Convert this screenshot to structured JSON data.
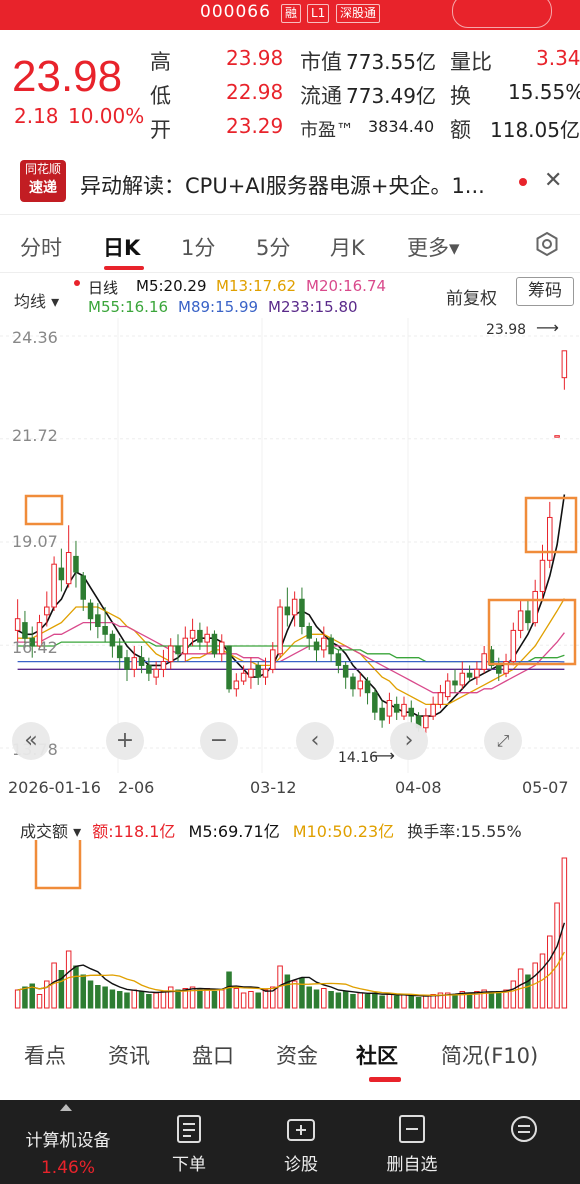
{
  "header": {
    "code": "000066",
    "tags": [
      "融",
      "L1",
      "深股通"
    ]
  },
  "quote": {
    "price": "23.98",
    "change": "2.18",
    "change_pct": "10.00%",
    "high_label": "高",
    "high": "23.98",
    "low_label": "低",
    "low": "22.98",
    "open_label": "开",
    "open": "23.29",
    "mktcap_label": "市值",
    "mktcap": "773.55亿",
    "float_label": "流通",
    "float": "773.49亿",
    "pe_label": "市盈™",
    "pe": "3834.40",
    "volratio_label": "量比",
    "volratio": "3.34",
    "turnover_label": "换",
    "turnover": "15.55%",
    "amount_label": "额",
    "amount": "118.05亿"
  },
  "news": {
    "logo_top": "同花顺",
    "logo_bottom": "速递",
    "text": "异动解读：CPU+AI服务器电源+央企。1..."
  },
  "period_tabs": [
    "分时",
    "日K",
    "1分",
    "5分",
    "月K",
    "更多▾"
  ],
  "ma_bar": {
    "left_label": "均线 ▾",
    "line_label": "日线",
    "m5": "M5:20.29",
    "m13": "M13:17.62",
    "m20": "M20:16.74",
    "m55": "M55:16.16",
    "m89": "M89:15.99",
    "m233": "M233:15.80",
    "adj_label": "前复权",
    "chips_label": "筹码"
  },
  "chart_data": {
    "type": "candlestick",
    "y_ticks": [
      "24.36",
      "21.72",
      "19.07",
      "16.42",
      "13.78"
    ],
    "x_ticks": [
      "2026-01-16",
      "2-06",
      "03-12",
      "04-08",
      "05-07"
    ],
    "high_marker": "23.98",
    "low_marker": "14.16",
    "candles": [
      [
        16.8,
        17.1,
        17.6,
        16.5
      ],
      [
        17.0,
        16.6,
        17.3,
        16.4
      ],
      [
        16.6,
        16.4,
        16.9,
        16.1
      ],
      [
        16.4,
        17.0,
        17.2,
        16.3
      ],
      [
        17.2,
        17.4,
        17.8,
        16.9
      ],
      [
        17.4,
        18.5,
        18.7,
        17.3
      ],
      [
        18.4,
        18.1,
        18.9,
        17.8
      ],
      [
        18.0,
        18.8,
        19.5,
        17.9
      ],
      [
        18.7,
        18.3,
        19.1,
        17.9
      ],
      [
        18.2,
        17.6,
        18.3,
        17.3
      ],
      [
        17.5,
        17.1,
        17.6,
        16.8
      ],
      [
        17.2,
        16.9,
        17.5,
        16.6
      ],
      [
        16.9,
        16.7,
        17.4,
        16.5
      ],
      [
        16.7,
        16.4,
        16.8,
        16.1
      ],
      [
        16.4,
        16.1,
        16.6,
        15.8
      ],
      [
        16.1,
        15.8,
        16.3,
        15.5
      ],
      [
        15.8,
        16.1,
        16.4,
        15.6
      ],
      [
        16.1,
        15.9,
        16.4,
        15.7
      ],
      [
        15.9,
        15.7,
        16.1,
        15.5
      ],
      [
        15.6,
        15.8,
        16.0,
        15.4
      ],
      [
        15.8,
        16.0,
        16.3,
        15.6
      ],
      [
        16.0,
        16.4,
        16.6,
        15.8
      ],
      [
        16.4,
        16.2,
        16.7,
        16.0
      ],
      [
        16.2,
        16.6,
        16.9,
        16.0
      ],
      [
        16.6,
        16.8,
        17.1,
        16.4
      ],
      [
        16.8,
        16.5,
        17.0,
        16.3
      ],
      [
        16.5,
        16.7,
        16.9,
        16.2
      ],
      [
        16.7,
        16.2,
        16.8,
        16.1
      ],
      [
        16.2,
        16.5,
        16.7,
        16.0
      ],
      [
        16.4,
        15.3,
        16.4,
        15.2
      ],
      [
        15.3,
        15.5,
        15.7,
        15.1
      ],
      [
        15.5,
        15.7,
        15.9,
        15.4
      ],
      [
        15.6,
        15.8,
        16.1,
        15.3
      ],
      [
        15.9,
        15.6,
        16.0,
        15.4
      ],
      [
        15.6,
        15.8,
        16.1,
        15.4
      ],
      [
        15.8,
        16.3,
        16.5,
        15.7
      ],
      [
        16.2,
        17.4,
        17.6,
        16.1
      ],
      [
        17.4,
        17.2,
        17.9,
        16.9
      ],
      [
        17.2,
        17.6,
        17.8,
        16.9
      ],
      [
        17.6,
        16.9,
        17.9,
        16.7
      ],
      [
        16.9,
        16.6,
        17.0,
        16.3
      ],
      [
        16.5,
        16.3,
        16.6,
        16.0
      ],
      [
        16.3,
        16.6,
        16.9,
        16.1
      ],
      [
        16.6,
        16.2,
        16.7,
        16.0
      ],
      [
        16.2,
        15.9,
        16.3,
        15.7
      ],
      [
        15.9,
        15.6,
        16.0,
        15.3
      ],
      [
        15.6,
        15.3,
        15.7,
        15.1
      ],
      [
        15.3,
        15.5,
        15.7,
        15.1
      ],
      [
        15.5,
        15.2,
        15.6,
        14.9
      ],
      [
        15.2,
        14.7,
        15.3,
        14.5
      ],
      [
        14.8,
        14.5,
        15.0,
        14.3
      ],
      [
        14.6,
        15.0,
        15.2,
        14.4
      ],
      [
        14.9,
        14.7,
        15.1,
        14.5
      ],
      [
        14.6,
        14.9,
        15.1,
        14.5
      ],
      [
        14.8,
        14.6,
        15.0,
        14.4
      ],
      [
        14.6,
        14.3,
        14.7,
        14.2
      ],
      [
        14.3,
        14.6,
        14.8,
        14.16
      ],
      [
        14.6,
        14.9,
        15.1,
        14.5
      ],
      [
        14.9,
        15.2,
        15.4,
        14.8
      ],
      [
        15.1,
        15.5,
        15.7,
        15.0
      ],
      [
        15.5,
        15.4,
        15.8,
        15.2
      ],
      [
        15.4,
        15.7,
        16.0,
        15.3
      ],
      [
        15.7,
        15.6,
        15.9,
        15.5
      ],
      [
        15.6,
        15.8,
        16.0,
        15.4
      ],
      [
        15.8,
        16.2,
        16.4,
        15.7
      ],
      [
        16.3,
        15.9,
        16.4,
        15.8
      ],
      [
        15.9,
        15.7,
        16.1,
        15.5
      ],
      [
        15.7,
        16.0,
        16.2,
        15.6
      ],
      [
        16.0,
        16.8,
        17.0,
        15.9
      ],
      [
        16.8,
        17.3,
        17.6,
        16.6
      ],
      [
        17.3,
        17.0,
        17.6,
        16.8
      ],
      [
        17.0,
        17.8,
        18.1,
        16.9
      ],
      [
        17.8,
        18.6,
        19.0,
        17.6
      ],
      [
        18.6,
        19.7,
        20.1,
        18.4
      ],
      [
        21.8,
        21.8,
        21.8,
        21.8
      ],
      [
        23.29,
        23.98,
        23.98,
        22.98
      ]
    ],
    "ma_lines": {
      "m5": [
        16.8,
        16.7,
        16.7,
        16.8,
        17.0,
        17.4,
        17.6,
        18.0,
        18.3,
        18.2,
        17.9,
        17.6,
        17.3,
        17.0,
        16.7,
        16.4,
        16.2,
        16.1,
        15.9,
        15.9,
        15.9,
        16.0,
        16.1,
        16.3,
        16.5,
        16.6,
        16.6,
        16.6,
        16.5,
        16.2,
        16.0,
        15.8,
        15.6,
        15.6,
        15.7,
        15.9,
        16.3,
        16.8,
        17.2,
        17.3,
        17.2,
        16.9,
        16.7,
        16.5,
        16.4,
        16.2,
        15.9,
        15.7,
        15.5,
        15.3,
        15.0,
        14.9,
        14.8,
        14.7,
        14.7,
        14.6,
        14.6,
        14.6,
        14.7,
        14.9,
        15.1,
        15.3,
        15.5,
        15.6,
        15.7,
        15.8,
        15.9,
        15.9,
        16.1,
        16.4,
        16.7,
        17.1,
        17.6,
        18.2,
        19.0,
        20.29
      ],
      "m13": [
        16.6,
        16.6,
        16.6,
        16.7,
        16.8,
        16.9,
        17.0,
        17.2,
        17.4,
        17.4,
        17.4,
        17.4,
        17.3,
        17.2,
        17.1,
        16.9,
        16.8,
        16.6,
        16.4,
        16.2,
        16.1,
        16.0,
        16.0,
        16.0,
        16.1,
        16.1,
        16.2,
        16.3,
        16.3,
        16.2,
        16.1,
        16.0,
        16.0,
        15.9,
        15.9,
        15.9,
        16.1,
        16.3,
        16.5,
        16.6,
        16.7,
        16.7,
        16.7,
        16.6,
        16.5,
        16.4,
        16.3,
        16.2,
        16.0,
        15.8,
        15.6,
        15.5,
        15.3,
        15.2,
        15.1,
        15.0,
        14.9,
        14.9,
        14.9,
        14.9,
        15.0,
        15.1,
        15.2,
        15.3,
        15.4,
        15.5,
        15.6,
        15.7,
        15.8,
        16.0,
        16.2,
        16.4,
        16.7,
        17.0,
        17.3,
        17.62
      ],
      "m20": [
        16.5,
        16.5,
        16.5,
        16.5,
        16.6,
        16.7,
        16.7,
        16.8,
        16.9,
        17.0,
        17.0,
        17.0,
        17.0,
        17.0,
        16.9,
        16.9,
        16.8,
        16.7,
        16.6,
        16.5,
        16.4,
        16.3,
        16.2,
        16.2,
        16.2,
        16.2,
        16.2,
        16.2,
        16.2,
        16.2,
        16.2,
        16.1,
        16.1,
        16.1,
        16.0,
        16.0,
        16.0,
        16.1,
        16.2,
        16.3,
        16.4,
        16.4,
        16.4,
        16.4,
        16.4,
        16.4,
        16.3,
        16.2,
        16.1,
        16.0,
        15.9,
        15.8,
        15.7,
        15.6,
        15.5,
        15.4,
        15.3,
        15.2,
        15.2,
        15.2,
        15.2,
        15.2,
        15.2,
        15.2,
        15.3,
        15.3,
        15.4,
        15.5,
        15.6,
        15.7,
        15.8,
        15.9,
        16.1,
        16.3,
        16.5,
        16.74
      ],
      "m55": [
        16.4,
        16.4,
        16.4,
        16.4,
        16.4,
        16.4,
        16.5,
        16.5,
        16.5,
        16.5,
        16.5,
        16.5,
        16.5,
        16.5,
        16.5,
        16.5,
        16.5,
        16.5,
        16.5,
        16.4,
        16.4,
        16.4,
        16.4,
        16.4,
        16.4,
        16.4,
        16.4,
        16.4,
        16.4,
        16.4,
        16.4,
        16.4,
        16.4,
        16.4,
        16.4,
        16.4,
        16.4,
        16.4,
        16.4,
        16.4,
        16.4,
        16.4,
        16.4,
        16.4,
        16.3,
        16.3,
        16.3,
        16.3,
        16.2,
        16.2,
        16.2,
        16.2,
        16.1,
        16.1,
        16.1,
        16.1,
        16.0,
        16.0,
        16.0,
        16.0,
        16.0,
        16.0,
        16.0,
        16.0,
        16.0,
        16.0,
        16.0,
        16.0,
        16.0,
        16.0,
        16.0,
        16.1,
        16.1,
        16.1,
        16.1,
        16.16
      ],
      "m89": [
        16.0,
        16.0,
        16.0,
        16.0,
        16.0,
        16.0,
        16.0,
        16.0,
        16.0,
        16.0,
        16.0,
        16.0,
        16.0,
        16.0,
        16.0,
        16.0,
        16.0,
        16.0,
        16.0,
        16.0,
        16.0,
        16.0,
        16.0,
        16.0,
        16.0,
        16.0,
        16.0,
        16.0,
        16.0,
        16.0,
        16.0,
        16.0,
        16.0,
        16.0,
        16.0,
        16.0,
        16.0,
        16.0,
        16.0,
        16.0,
        16.0,
        16.0,
        16.0,
        16.0,
        16.0,
        16.0,
        16.0,
        16.0,
        16.0,
        16.0,
        16.0,
        16.0,
        16.0,
        16.0,
        16.0,
        16.0,
        16.0,
        16.0,
        16.0,
        16.0,
        16.0,
        16.0,
        16.0,
        16.0,
        16.0,
        16.0,
        16.0,
        16.0,
        16.0,
        16.0,
        16.0,
        16.0,
        16.0,
        16.0,
        16.0,
        15.99
      ],
      "m233": [
        15.8,
        15.8,
        15.8,
        15.8,
        15.8,
        15.8,
        15.8,
        15.8,
        15.8,
        15.8,
        15.8,
        15.8,
        15.8,
        15.8,
        15.8,
        15.8,
        15.8,
        15.8,
        15.8,
        15.8,
        15.8,
        15.8,
        15.8,
        15.8,
        15.8,
        15.8,
        15.8,
        15.8,
        15.8,
        15.8,
        15.8,
        15.8,
        15.8,
        15.8,
        15.8,
        15.8,
        15.8,
        15.8,
        15.8,
        15.8,
        15.8,
        15.8,
        15.8,
        15.8,
        15.8,
        15.8,
        15.8,
        15.8,
        15.8,
        15.8,
        15.8,
        15.8,
        15.8,
        15.8,
        15.8,
        15.8,
        15.8,
        15.8,
        15.8,
        15.8,
        15.8,
        15.8,
        15.8,
        15.8,
        15.8,
        15.8,
        15.8,
        15.8,
        15.8,
        15.8,
        15.8,
        15.8,
        15.8,
        15.8,
        15.8,
        15.8
      ]
    },
    "volumes": [
      12,
      14,
      16,
      9,
      18,
      30,
      25,
      38,
      28,
      22,
      18,
      15,
      14,
      12,
      11,
      10,
      12,
      11,
      9,
      10,
      11,
      14,
      12,
      13,
      14,
      12,
      13,
      11,
      12,
      24,
      13,
      10,
      11,
      10,
      12,
      14,
      28,
      22,
      18,
      20,
      14,
      12,
      13,
      11,
      10,
      11,
      9,
      10,
      9,
      10,
      8,
      9,
      8,
      9,
      8,
      7,
      8,
      9,
      10,
      10,
      9,
      11,
      10,
      11,
      12,
      10,
      11,
      12,
      18,
      26,
      22,
      30,
      36,
      48,
      70,
      100
    ]
  },
  "volume_bar": {
    "label": "成交额 ▾",
    "amount": "额:118.1亿",
    "m5": "M5:69.71亿",
    "m10": "M10:50.23亿",
    "turnover": "换手率:15.55%"
  },
  "bottom_tabs": [
    "看点",
    "资讯",
    "盘口",
    "资金",
    "社区",
    "简况(F10)"
  ],
  "bottom_bar": {
    "sector_name": "计算机设备",
    "sector_pct": "1.46%",
    "buttons": [
      "下单",
      "诊股",
      "删自选",
      ""
    ]
  },
  "colors": {
    "up": "#e8232b",
    "down": "#2e7d32",
    "m5": "#111111",
    "m13": "#e0a000",
    "m20": "#d94a8c",
    "m55": "#3aa53a",
    "m89": "#3a63c7",
    "m233": "#5a2a8a",
    "box": "#f08c3a"
  }
}
